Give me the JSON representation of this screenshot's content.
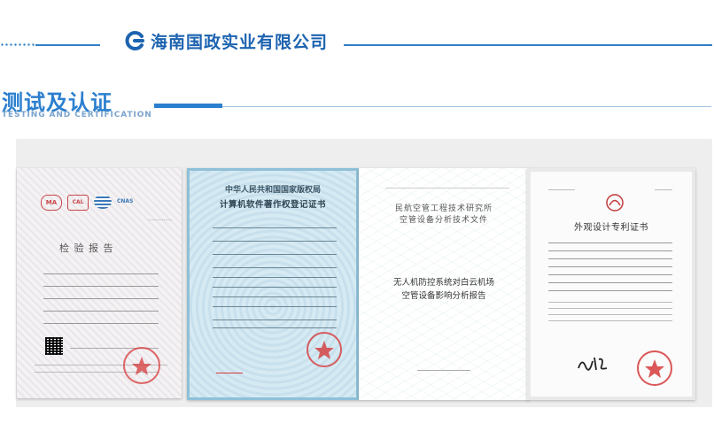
{
  "header": {
    "company_name": "海南国政实业有限公司"
  },
  "section": {
    "title": "测试及认证",
    "subtitle": "TESTING AND CERTIFICATION"
  },
  "colors": {
    "accent": "#2b7fcf",
    "brand": "#1d63b0",
    "gallery_bg": "#eeeeee",
    "seal_red": "#d63a3a"
  },
  "certificates": [
    {
      "title": "检 验 报 告",
      "marks": [
        "MA",
        "CAL",
        "CNAS"
      ]
    },
    {
      "authority": "中华人民共和国国家版权局",
      "title": "计算机软件著作权登记证书"
    },
    {
      "org_line1": "民航空管工程技术研究所",
      "org_line2": "空管设备分析技术文件",
      "title_line1": "无人机防控系统对白云机场",
      "title_line2": "空管设备影响分析报告"
    },
    {
      "title": "外观设计专利证书"
    }
  ]
}
